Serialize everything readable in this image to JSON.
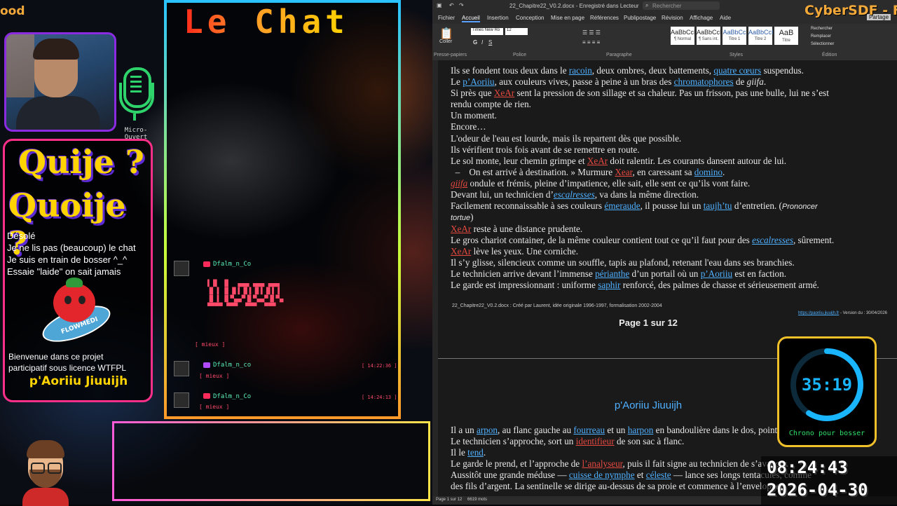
{
  "overlay": {
    "brand_left": "ood",
    "mic_label": "Micro-Ouvert",
    "panel": {
      "title1": "Quije ?",
      "title2": "Quoije ?",
      "messages": [
        "Désolé",
        "Je ne lis pas (beaucoup) le chat",
        "Je suis en train de bosser ^_^",
        "Essaie \"laide\" on sait jamais"
      ],
      "sticker_text": "FLOWMEDI",
      "welcome": [
        "Bienvenue dans ce projet",
        "participatif sous licence WTFPL"
      ],
      "brand": "p'Aoriiu Jiuuijh"
    },
    "chat": {
      "title": "Le Chat",
      "messages": [
        {
          "user": "Dfalm_n_Co",
          "sub": "[ mieux ]",
          "time": ""
        },
        {
          "user": "Dfalm_n_co",
          "sub": "[ mieux ]",
          "time": "[ 14:22:36 ]"
        },
        {
          "user": "Dfalm_n_Co",
          "sub": "[ mieux ]",
          "time": "[ 14:24:13 ]"
        }
      ]
    },
    "brand_right": "CyberSDF - Fr",
    "chrono": {
      "time": "35:19",
      "label": "Chrono pour bosser",
      "progress": 0.59
    },
    "clock": {
      "time": "08:24:43",
      "date": "2026-04-30"
    }
  },
  "word": {
    "title": "22_Chapitre22_V0.2.docx - Enregistré dans Lecteur",
    "search_placeholder": "Rechercher",
    "share_label": "Partage",
    "tabs": [
      "Fichier",
      "Accueil",
      "Insertion",
      "Conception",
      "Mise en page",
      "Références",
      "Publipostage",
      "Révision",
      "Affichage",
      "Aide"
    ],
    "font_name": "Times New Ro",
    "font_size": "12",
    "styles": [
      {
        "sample": "AaBbCcI",
        "name": "¶ Normal"
      },
      {
        "sample": "AaBbCcI",
        "name": "¶ Sans int."
      },
      {
        "sample": "AaBbCc",
        "name": "Titre 1"
      },
      {
        "sample": "AaBbCcI",
        "name": "Titre 2"
      },
      {
        "sample": "AaB",
        "name": "Titre"
      }
    ],
    "group_labels": [
      "Presse-papiers",
      "Police",
      "Paragraphe",
      "Styles",
      "Édition"
    ],
    "paste_label": "Coller",
    "editing": [
      "Rechercher",
      "Remplacer",
      "Sélectionner"
    ],
    "footer_left": "22_Chapitre22_V0.2.docx : Créé par Laurent, idée originale 1996-1997, formalisation 2002-2004",
    "footer_link": "https://paoriiu.jiuuijh.fr",
    "footer_right": " - Version du : 30/04/2026",
    "page_label": "Page 1 sur 12",
    "heading": "p'Aoriiu Jiuuijh",
    "status_page": "Page 1 sur 12",
    "status_words": "6619 mots"
  }
}
